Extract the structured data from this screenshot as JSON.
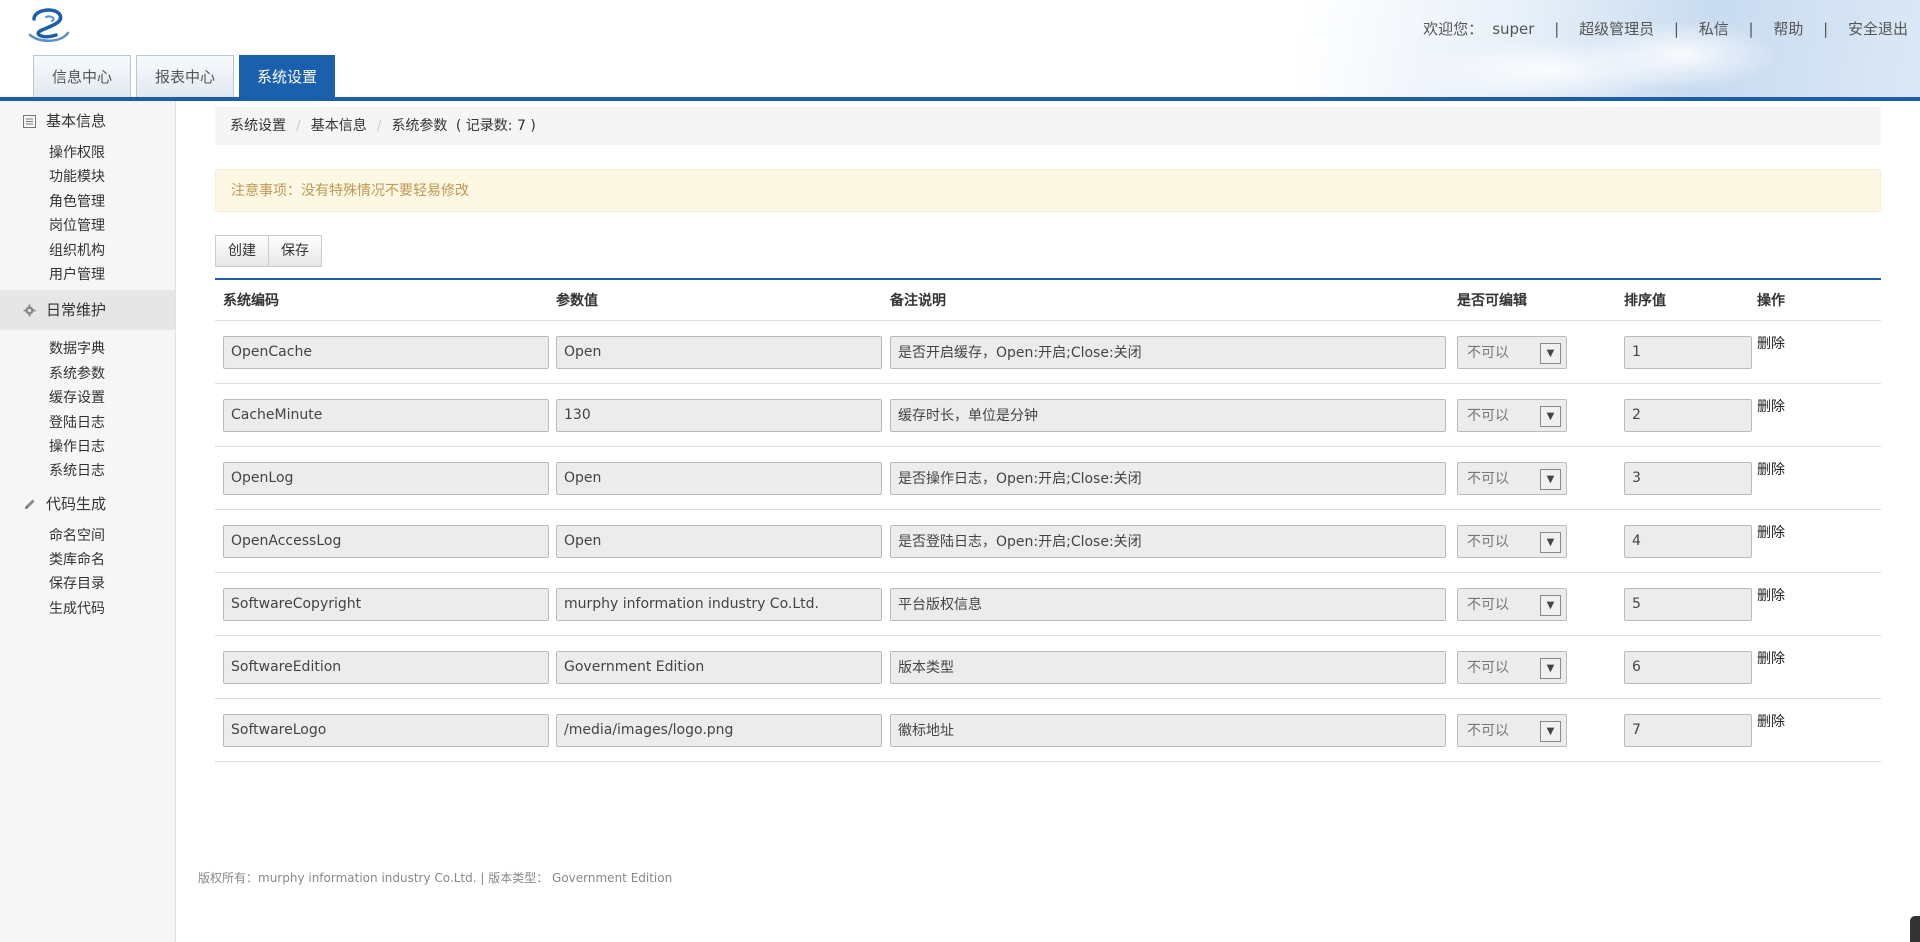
{
  "header": {
    "welcome_label": "欢迎您：",
    "username": "super",
    "role": "超级管理员",
    "links": [
      "私信",
      "帮助",
      "安全退出"
    ],
    "separator": "|",
    "tabs": [
      {
        "label": "信息中心",
        "active": false
      },
      {
        "label": "报表中心",
        "active": false
      },
      {
        "label": "系统设置",
        "active": true
      }
    ]
  },
  "sidebar": {
    "groups": [
      {
        "label": "基本信息",
        "icon": "list-icon",
        "active": false,
        "items": [
          "操作权限",
          "功能模块",
          "角色管理",
          "岗位管理",
          "组织机构",
          "用户管理"
        ]
      },
      {
        "label": "日常维护",
        "icon": "gear-icon",
        "active": true,
        "items": [
          "数据字典",
          "系统参数",
          "缓存设置",
          "登陆日志",
          "操作日志",
          "系统日志"
        ]
      },
      {
        "label": "代码生成",
        "icon": "pencil-icon",
        "active": false,
        "items": [
          "命名空间",
          "类库命名",
          "保存目录",
          "生成代码"
        ]
      }
    ]
  },
  "breadcrumb": {
    "items": [
      "系统设置",
      "基本信息",
      "系统参数"
    ],
    "separator": "/",
    "record_count": "( 记录数: 7 )"
  },
  "notice": "注意事项：没有特殊情况不要轻易修改",
  "toolbar": {
    "create_label": "创建",
    "save_label": "保存"
  },
  "table": {
    "headers": [
      "系统编码",
      "参数值",
      "备注说明",
      "是否可编辑",
      "排序值",
      "操作"
    ],
    "rows": [
      {
        "code": "OpenCache",
        "value": "Open",
        "remark": "是否开启缓存，Open:开启;Close:关闭",
        "editable": "不可以",
        "sort": "1",
        "action": "删除"
      },
      {
        "code": "CacheMinute",
        "value": "130",
        "remark": "缓存时长，单位是分钟",
        "editable": "不可以",
        "sort": "2",
        "action": "删除"
      },
      {
        "code": "OpenLog",
        "value": "Open",
        "remark": "是否操作日志，Open:开启;Close:关闭",
        "editable": "不可以",
        "sort": "3",
        "action": "删除"
      },
      {
        "code": "OpenAccessLog",
        "value": "Open",
        "remark": "是否登陆日志，Open:开启;Close:关闭",
        "editable": "不可以",
        "sort": "4",
        "action": "删除"
      },
      {
        "code": "SoftwareCopyright",
        "value": "murphy information industry Co.Ltd.",
        "remark": "平台版权信息",
        "editable": "不可以",
        "sort": "5",
        "action": "删除"
      },
      {
        "code": "SoftwareEdition",
        "value": "Government Edition",
        "remark": "版本类型",
        "editable": "不可以",
        "sort": "6",
        "action": "删除"
      },
      {
        "code": "SoftwareLogo",
        "value": "/media/images/logo.png",
        "remark": "徽标地址",
        "editable": "不可以",
        "sort": "7",
        "action": "删除"
      }
    ]
  },
  "footer": "版权所有：murphy information industry Co.Ltd. | 版本类型： Government Edition",
  "colors": {
    "accent": "#1b5ea9",
    "notice_bg": "#fcf8e3",
    "notice_text": "#c09853"
  }
}
